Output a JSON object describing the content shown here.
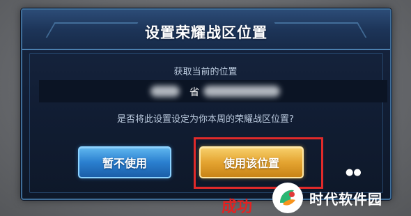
{
  "dialog": {
    "title": "设置荣耀战区位置",
    "subtitle": "获取当前的位置",
    "location_partial": "省",
    "question": "是否将此设置设定为你本周的荣耀战区位置?"
  },
  "buttons": {
    "cancel_label": "暂不使用",
    "confirm_label": "使用该位置"
  },
  "annotation": {
    "text": "成功",
    "color": "#e22222"
  },
  "watermark": {
    "text": "时代软件园"
  },
  "colors": {
    "dialog_bg": "#131f36",
    "cancel_button": "#2a7fcf",
    "confirm_button": "#e4a431",
    "highlight": "#e02a2a"
  }
}
